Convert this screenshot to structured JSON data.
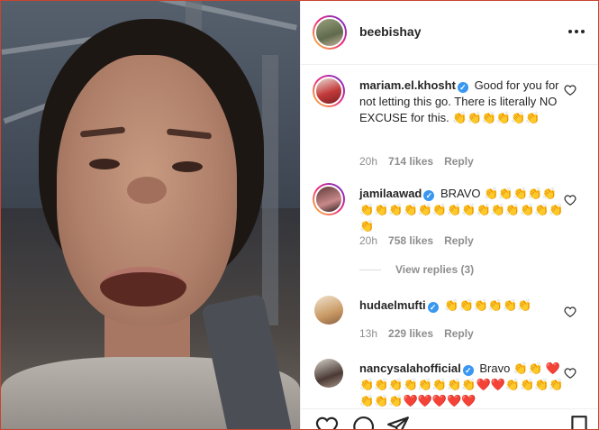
{
  "post": {
    "author": "beebishay"
  },
  "header": {
    "more_icon": "more-horizontal-icon"
  },
  "comments": [
    {
      "user": "mariam.el.khosht",
      "verified": true,
      "text": "Good for you for not letting this go. There is literally NO EXCUSE for this. 👏👏👏👏👏👏",
      "time": "20h",
      "likes": "714 likes",
      "reply": "Reply"
    },
    {
      "user": "jamilaawad",
      "verified": true,
      "text": "BRAVO 👏👏👏👏👏👏👏👏👏👏👏👏👏👏👏👏👏👏👏👏",
      "time": "20h",
      "likes": "758 likes",
      "reply": "Reply",
      "view_replies": "View replies (3)"
    },
    {
      "user": "hudaelmufti",
      "verified": true,
      "text": "👏👏👏👏👏👏",
      "time": "13h",
      "likes": "229 likes",
      "reply": "Reply"
    },
    {
      "user": "nancysalahofficial",
      "verified": true,
      "text": "Bravo 👏👏 ❤️👏👏👏👏👏👏👏👏❤️❤️👏👏👏👏👏👏👏❤️❤️❤️❤️❤️",
      "time": "",
      "likes": "",
      "reply": ""
    }
  ],
  "actions": {
    "like_icon": "heart-outline-icon",
    "comment_icon": "comment-bubble-icon",
    "share_icon": "paper-plane-icon",
    "save_icon": "bookmark-icon"
  },
  "colors": {
    "text": "#262626",
    "meta": "#8e8e8e",
    "verified": "#3897f0",
    "frame_border": "#c8442f"
  }
}
